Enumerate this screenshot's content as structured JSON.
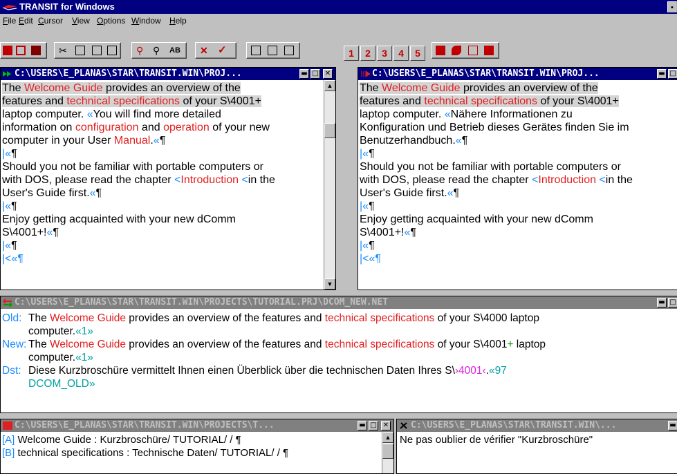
{
  "app": {
    "title": "TRANSIT for Windows",
    "sys_button": "▪"
  },
  "menu": [
    "File",
    "Edit",
    "Cursor",
    "View",
    "Options",
    "Window",
    "Help"
  ],
  "toolbar": {
    "numbers": [
      "1",
      "2",
      "3",
      "4",
      "5"
    ]
  },
  "source_window": {
    "title": "C:\\USERS\\E_PLANAS\\STAR\\TRANSIT.WIN\\PROJ...",
    "lines": [
      {
        "parts": [
          [
            "The ",
            ""
          ],
          [
            "Welcome Guide",
            "red"
          ],
          [
            " provides an overview of the",
            ""
          ]
        ],
        "hl": true
      },
      {
        "parts": [
          [
            "features and ",
            ""
          ],
          [
            "technical specifications",
            "red"
          ],
          [
            " of your S\\4001+",
            ""
          ]
        ],
        "hl": true
      },
      {
        "parts": [
          [
            "laptop computer. ",
            ""
          ],
          [
            "«",
            "blue"
          ],
          [
            "You will find more detailed",
            ""
          ]
        ],
        "hl": false
      },
      {
        "parts": [
          [
            "information on ",
            ""
          ],
          [
            "configuration",
            "red"
          ],
          [
            " and ",
            ""
          ],
          [
            "operation",
            "red"
          ],
          [
            " of your new",
            ""
          ]
        ],
        "hl": false
      },
      {
        "parts": [
          [
            "computer in your User ",
            ""
          ],
          [
            "Manual",
            "red"
          ],
          [
            ".",
            ""
          ],
          [
            "«",
            "blue"
          ],
          [
            "¶",
            ""
          ]
        ],
        "hl": false
      },
      {
        "parts": [
          [
            "|«",
            "blue"
          ],
          [
            "¶",
            ""
          ]
        ],
        "hl": false
      },
      {
        "parts": [
          [
            "Should you not be familiar with portable computers or",
            ""
          ]
        ],
        "hl": false
      },
      {
        "parts": [
          [
            "with DOS, please read the chapter ",
            ""
          ],
          [
            "<",
            "blue"
          ],
          [
            "Introduction",
            "red"
          ],
          [
            " <",
            "blue"
          ],
          [
            "in the",
            ""
          ]
        ],
        "hl": false
      },
      {
        "parts": [
          [
            "User's Guide first.",
            ""
          ],
          [
            "«",
            "blue"
          ],
          [
            "¶",
            ""
          ]
        ],
        "hl": false
      },
      {
        "parts": [
          [
            "|«",
            "blue"
          ],
          [
            "¶",
            ""
          ]
        ],
        "hl": false
      },
      {
        "parts": [
          [
            "Enjoy getting acquainted with your new dComm",
            ""
          ]
        ],
        "hl": false
      },
      {
        "parts": [
          [
            "S\\4001+!",
            ""
          ],
          [
            "«",
            "blue"
          ],
          [
            "¶",
            ""
          ]
        ],
        "hl": false
      },
      {
        "parts": [
          [
            "|«",
            "blue"
          ],
          [
            "¶",
            ""
          ]
        ],
        "hl": false
      },
      {
        "parts": [
          [
            "|<«¶",
            "blue"
          ]
        ],
        "hl": false
      }
    ]
  },
  "target_window": {
    "title": "C:\\USERS\\E_PLANAS\\STAR\\TRANSIT.WIN\\PROJ...",
    "lines": [
      {
        "parts": [
          [
            "The ",
            ""
          ],
          [
            "Welcome Guide",
            "red"
          ],
          [
            " provides an overview of the",
            ""
          ]
        ],
        "hl": true
      },
      {
        "parts": [
          [
            "features and ",
            ""
          ],
          [
            "technical specifications",
            "red"
          ],
          [
            " of your S\\4001+",
            ""
          ]
        ],
        "hl": true
      },
      {
        "parts": [
          [
            "laptop computer. ",
            ""
          ],
          [
            "«",
            "blue"
          ],
          [
            "Nähere Informationen zu",
            ""
          ]
        ],
        "hl": false
      },
      {
        "parts": [
          [
            "Konfiguration und Betrieb dieses Gerätes finden Sie im",
            ""
          ]
        ],
        "hl": false
      },
      {
        "parts": [
          [
            "Benutzerhandbuch.",
            ""
          ],
          [
            "«",
            "blue"
          ],
          [
            "¶",
            ""
          ]
        ],
        "hl": false
      },
      {
        "parts": [
          [
            "|«",
            "blue"
          ],
          [
            "¶",
            ""
          ]
        ],
        "hl": false
      },
      {
        "parts": [
          [
            "Should you not be familiar with portable computers or",
            ""
          ]
        ],
        "hl": false
      },
      {
        "parts": [
          [
            "with DOS, please read the chapter ",
            ""
          ],
          [
            "<",
            "blue"
          ],
          [
            "Introduction",
            "red"
          ],
          [
            " <",
            "blue"
          ],
          [
            "in the",
            ""
          ]
        ],
        "hl": false
      },
      {
        "parts": [
          [
            "User's Guide first.",
            ""
          ],
          [
            "«",
            "blue"
          ],
          [
            "¶",
            ""
          ]
        ],
        "hl": false
      },
      {
        "parts": [
          [
            "|«",
            "blue"
          ],
          [
            "¶",
            ""
          ]
        ],
        "hl": false
      },
      {
        "parts": [
          [
            "Enjoy getting acquainted with your new dComm",
            ""
          ]
        ],
        "hl": false
      },
      {
        "parts": [
          [
            "S\\4001+!",
            ""
          ],
          [
            "«",
            "blue"
          ],
          [
            "¶",
            ""
          ]
        ],
        "hl": false
      },
      {
        "parts": [
          [
            "|«",
            "blue"
          ],
          [
            "¶",
            ""
          ]
        ],
        "hl": false
      },
      {
        "parts": [
          [
            "|<«¶",
            "blue"
          ]
        ],
        "hl": false
      }
    ]
  },
  "compare_window": {
    "title": "C:\\USERS\\E_PLANAS\\STAR\\TRANSIT.WIN\\PROJECTS\\TUTORIAL.PRJ\\DCOM_NEW.NET",
    "entries": [
      {
        "label": "Old:",
        "lines": [
          [
            [
              "The ",
              ""
            ],
            [
              "Welcome Guide",
              "red"
            ],
            [
              " provides an overview of the features and ",
              ""
            ],
            [
              "technical specifications",
              "red"
            ],
            [
              " of your S\\4000 laptop",
              ""
            ]
          ],
          [
            [
              "computer.",
              ""
            ],
            [
              "«1»",
              "teal"
            ]
          ]
        ]
      },
      {
        "label": "New:",
        "lines": [
          [
            [
              "The ",
              ""
            ],
            [
              "Welcome Guide",
              "red"
            ],
            [
              " provides an overview of the features and ",
              ""
            ],
            [
              "technical specifications",
              "red"
            ],
            [
              " of your S\\4001",
              ""
            ],
            [
              "+",
              "grn"
            ],
            [
              " laptop",
              ""
            ]
          ],
          [
            [
              "computer.",
              ""
            ],
            [
              "«1»",
              "teal"
            ]
          ]
        ]
      },
      {
        "label": "Dst:",
        "lines": [
          [
            [
              "Diese Kurzbroschüre vermittelt Ihnen einen Überblick über die technischen Daten Ihres S\\",
              ""
            ],
            [
              "›4001‹",
              "mag"
            ],
            [
              ".",
              ""
            ],
            [
              "«97",
              "teal"
            ]
          ],
          [
            [
              "DCOM_OLD»",
              "teal"
            ]
          ]
        ]
      }
    ]
  },
  "terminology_window": {
    "title": "C:\\USERS\\E_PLANAS\\STAR\\TRANSIT.WIN\\PROJECTS\\T...",
    "lines": [
      [
        [
          "[A]",
          "blue"
        ],
        [
          " Welcome Guide : Kurzbroschüre/ TUTORIAL/ / ¶",
          ""
        ]
      ],
      [
        [
          "[B]",
          "blue"
        ],
        [
          " technical specifications : Technische Daten/ TUTORIAL/ / ¶",
          ""
        ]
      ]
    ]
  },
  "notes_window": {
    "title": "C:\\USERS\\E_PLANAS\\STAR\\TRANSIT.WIN\\...",
    "text": "Ne pas oublier de vérifier \"Kurzbroschüre\""
  },
  "icons": {
    "min": "▬",
    "max": "□",
    "close": "✕",
    "up": "▲",
    "down": "▼"
  }
}
